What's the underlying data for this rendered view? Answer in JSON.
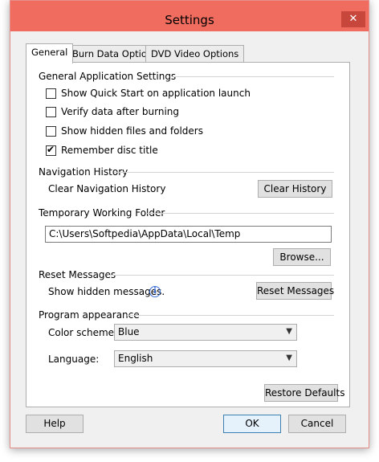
{
  "window": {
    "title": "Settings",
    "close_glyph": "✕"
  },
  "tabs": [
    {
      "label": "General"
    },
    {
      "label": "Burn Data Options"
    },
    {
      "label": "DVD Video Options"
    }
  ],
  "general_app": {
    "title": "General Application Settings",
    "checks": [
      {
        "label": "Show Quick Start on application launch",
        "checked": false
      },
      {
        "label": "Verify data after burning",
        "checked": false
      },
      {
        "label": "Show hidden files and folders",
        "checked": false
      },
      {
        "label": "Remember disc title",
        "checked": true
      }
    ],
    "check_glyph": "✔"
  },
  "nav_history": {
    "title": "Navigation History",
    "label": "Clear Navigation History",
    "button": "Clear History"
  },
  "temp_folder": {
    "title": "Temporary Working Folder",
    "path": "C:\\Users\\Softpedia\\AppData\\Local\\Temp",
    "browse": "Browse..."
  },
  "reset_messages": {
    "title": "Reset Messages",
    "label": "Show hidden messages.",
    "info_glyph": "i",
    "button": "Reset Messages"
  },
  "appearance": {
    "title": "Program appearance",
    "color_label": "Color scheme:",
    "color_value": "Blue",
    "language_label": "Language:",
    "language_value": "English",
    "restore": "Restore Defaults",
    "arrow_glyph": "▼"
  },
  "footer": {
    "help": "Help",
    "ok": "OK",
    "cancel": "Cancel"
  },
  "colors": {
    "titlebar": "#ef6c5f",
    "close": "#c7473d",
    "face": "#f0f0f0"
  }
}
